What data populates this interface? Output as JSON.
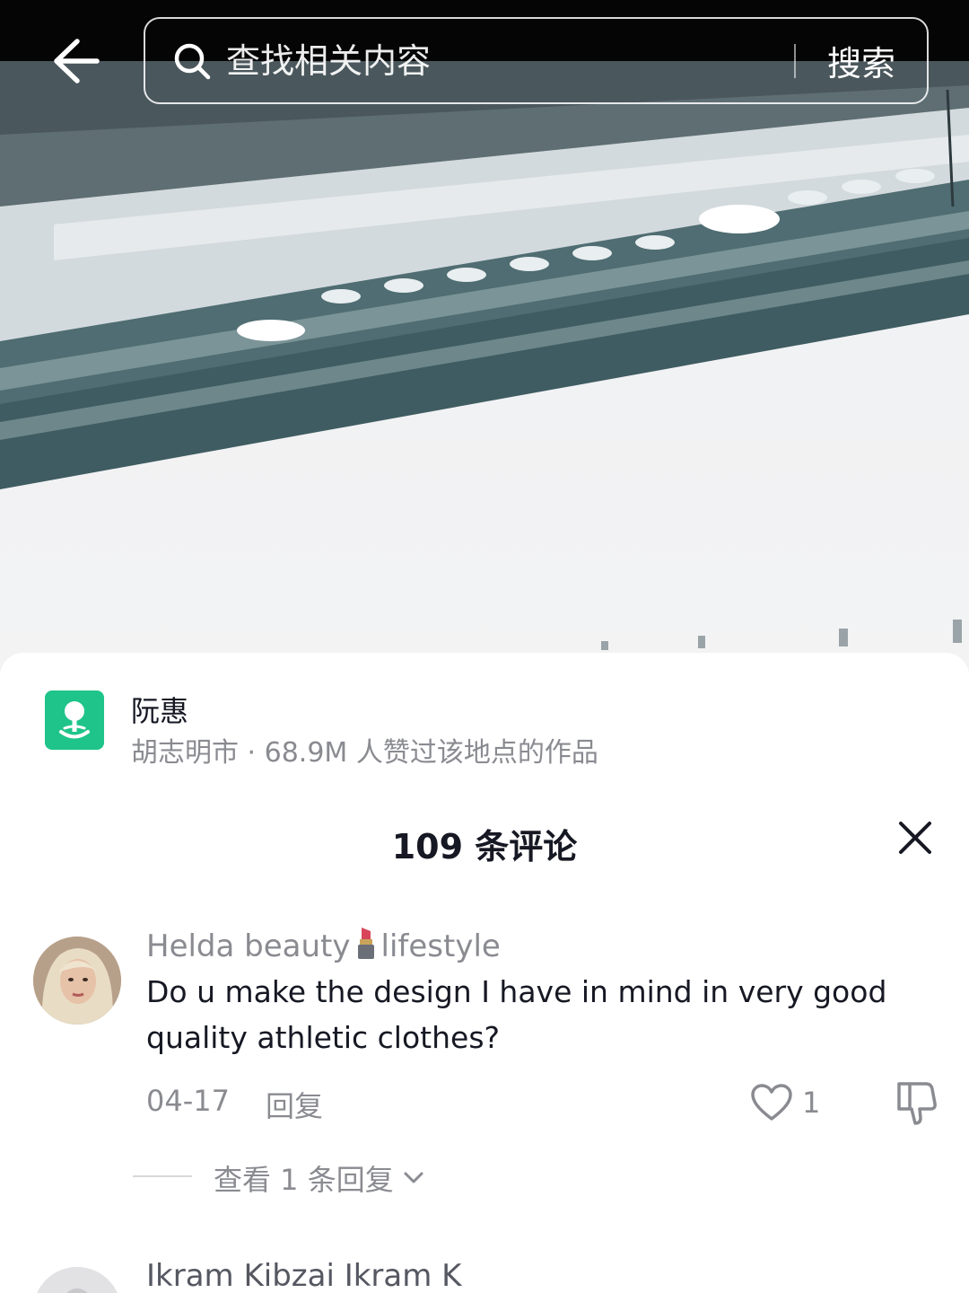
{
  "search": {
    "placeholder": "查找相关内容",
    "button_label": "搜索"
  },
  "location": {
    "name": "阮惠",
    "meta": "胡志明市 · 68.9M 人赞过该地点的作品"
  },
  "comments_header": {
    "title": "109 条评论"
  },
  "comments": [
    {
      "user_part1": "Helda beauty",
      "user_part2": "lifestyle",
      "text": "Do u make the design I have in mind in very good quality athletic clothes?",
      "date": "04-17",
      "reply_label": "回复",
      "likes": "1",
      "view_replies_label": "查看 1 条回复"
    },
    {
      "user_part1": "Ikram Kibzai Ikram K"
    }
  ],
  "colors": {
    "accent_location": "#1ec48a",
    "secondary_text": "#8a8b91",
    "primary_text": "#161823"
  }
}
